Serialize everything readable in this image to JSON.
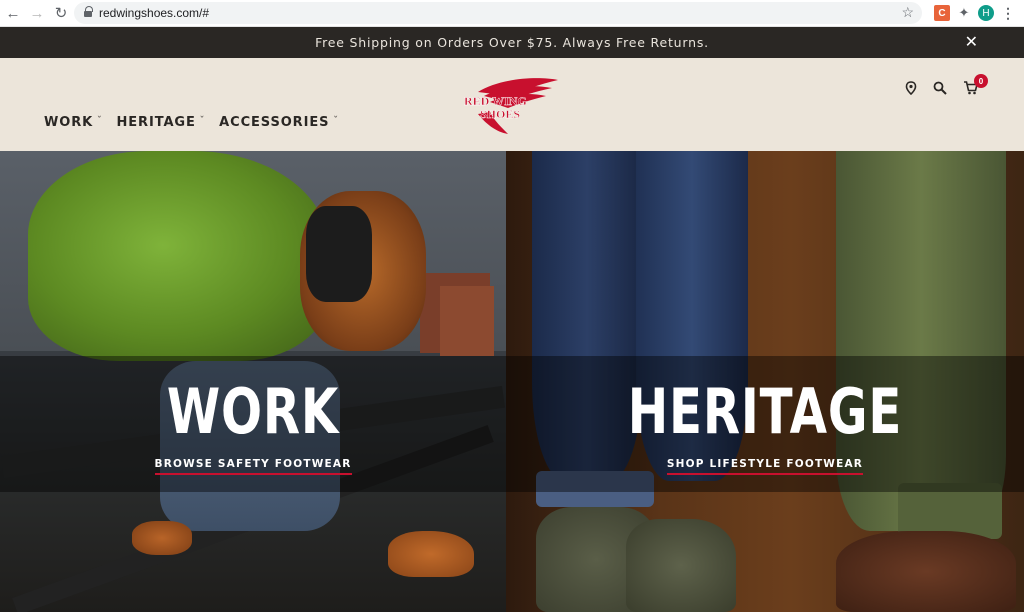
{
  "browser": {
    "url": "redwingshoes.com/#",
    "profile_initial": "H"
  },
  "promo": {
    "text": "Free Shipping on Orders Over $75. Always Free Returns."
  },
  "header": {
    "menu": [
      {
        "label": "WORK"
      },
      {
        "label": "HERITAGE"
      },
      {
        "label": "ACCESSORIES"
      }
    ],
    "logo": {
      "line1": "RED WING",
      "line2": "SHOES"
    },
    "cart_count": "0"
  },
  "hero": {
    "work": {
      "title": "WORK",
      "cta": "BROWSE SAFETY FOOTWEAR"
    },
    "heritage": {
      "title": "HERITAGE",
      "cta": "SHOP LIFESTYLE FOOTWEAR"
    }
  },
  "colors": {
    "accent_red": "#c8102e",
    "header_bg": "#ece5da",
    "promo_bg": "#2a2724"
  },
  "icons": [
    "back-icon",
    "forward-icon",
    "reload-icon",
    "lock-icon",
    "star-icon",
    "location-pin-icon",
    "search-icon",
    "cart-icon",
    "close-icon",
    "chevron-down-icon"
  ]
}
